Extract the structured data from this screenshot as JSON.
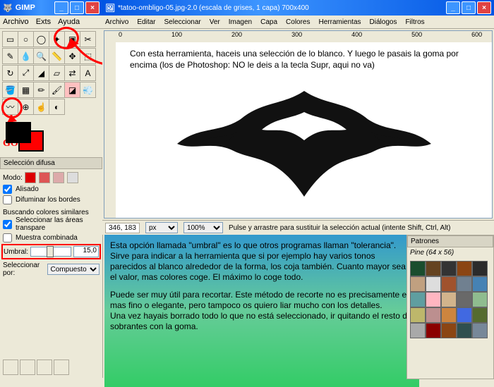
{
  "toolbox": {
    "title": "GIMP",
    "menu": [
      "Archivo",
      "Exts",
      "Ayuda"
    ],
    "panel_title": "Selección difusa",
    "mode_label": "Modo:",
    "alisado": "Alisado",
    "difuminar": "Difuminar los bordes",
    "colores_similares": "Buscando colores similares",
    "transparentes": "Seleccionar las áreas transpare",
    "muestra_combinada": "Muestra combinada",
    "umbral_label": "Umbral:",
    "umbral_value": "15,0",
    "seleccionar_por": "Seleccionar por:",
    "compuesto": "Compuesto",
    "goma_label": "GOMA"
  },
  "canvas": {
    "title": "*tatoo-ombligo-05.jpg-2.0 (escala de grises, 1 capa) 700x400",
    "menu": [
      "Archivo",
      "Editar",
      "Seleccionar",
      "Ver",
      "Imagen",
      "Capa",
      "Colores",
      "Herramientas",
      "Diálogos",
      "Filtros"
    ],
    "ruler_marks": [
      "0",
      "100",
      "200",
      "300",
      "400",
      "500",
      "600"
    ],
    "instruction": "Con esta herramienta, haceis una selección de lo blanco.  Y luego le pasais la goma por encima (los de Photoshop: NO le deis a la tecla Supr, aqui no va)",
    "coords": "346, 183",
    "unit": "px",
    "zoom": "100%",
    "status": "Pulse y arrastre para sustituir la selección actual (intente Shift, Ctrl, Alt)"
  },
  "explain": {
    "p1": "Esta opción llamada \"umbral\" es lo que otros programas llaman \"tolerancia\". Sirve para indicar a la herramienta que si por ejemplo hay varios tonos parecidos al blanco alrededor de la forma, los coja también. Cuanto mayor sea el valor, mas colores coge. El máximo lo coge todo.",
    "p2": "Puede ser muy útil para recortar. Este método de recorte no es precisamente el mas fino o elegante, pero tampoco os quiero liar mucho con los detalles.",
    "p3": "Una vez hayais borrado todo lo que no está seleccionado, ir quitando el resto de sobrantes con la goma."
  },
  "patterns": {
    "title": "Patrones",
    "selected": "Pine (64 x 56)",
    "colors": [
      "#1a4d2e",
      "#654321",
      "#333",
      "#8b4513",
      "#2b2b2b",
      "#c0a080",
      "#ddd",
      "#a0522d",
      "#708090",
      "#4682b4",
      "#5f9ea0",
      "#ffb6c1",
      "#d2b48c",
      "#696969",
      "#8fbc8f",
      "#bdb76b",
      "#bc8f8f",
      "#cd853f",
      "#4169e1",
      "#556b2f",
      "#a9a9a9",
      "#8b0000",
      "#8b4513",
      "#2f4f4f",
      "#778899"
    ]
  }
}
